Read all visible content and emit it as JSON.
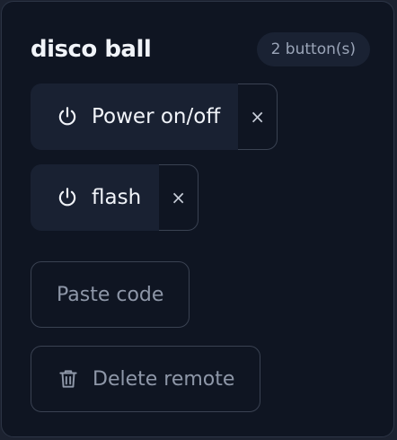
{
  "remote": {
    "name": "disco ball",
    "button_count": "2 button(s)"
  },
  "buttons": [
    {
      "label": "Power on/off",
      "icon": "power-icon",
      "remove_label": "×"
    },
    {
      "label": "flash",
      "icon": "power-icon",
      "remove_label": "×"
    }
  ],
  "actions": {
    "paste_code_label": "Paste code",
    "delete_remote_label": "Delete remote",
    "delete_icon": "trash-icon"
  },
  "colors": {
    "background": "#0f1522",
    "button_fill": "#192132",
    "border": "#3a4252",
    "text_primary": "#f1f4f9",
    "text_muted": "#8e97a8"
  }
}
